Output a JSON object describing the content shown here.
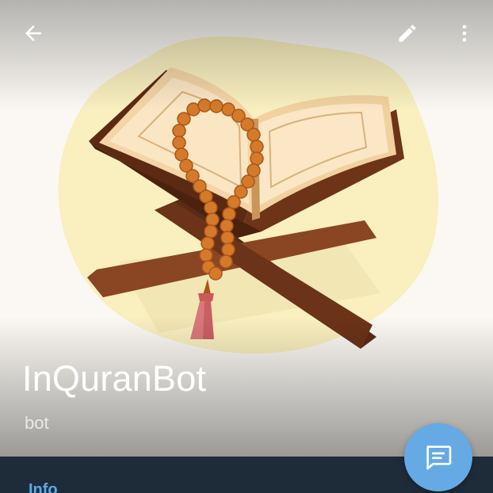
{
  "profile": {
    "name": "InQuranBot",
    "status": "bot"
  },
  "sections": {
    "info_header": "Info"
  },
  "toolbar": {
    "back_icon": "arrow-left-icon",
    "edit_icon": "pencil-icon",
    "more_icon": "more-vertical-icon"
  },
  "fab": {
    "icon": "message-icon"
  },
  "colors": {
    "accent": "#65aae4",
    "info_header": "#5aa9e6",
    "panel_background": "#1e2c3a"
  }
}
